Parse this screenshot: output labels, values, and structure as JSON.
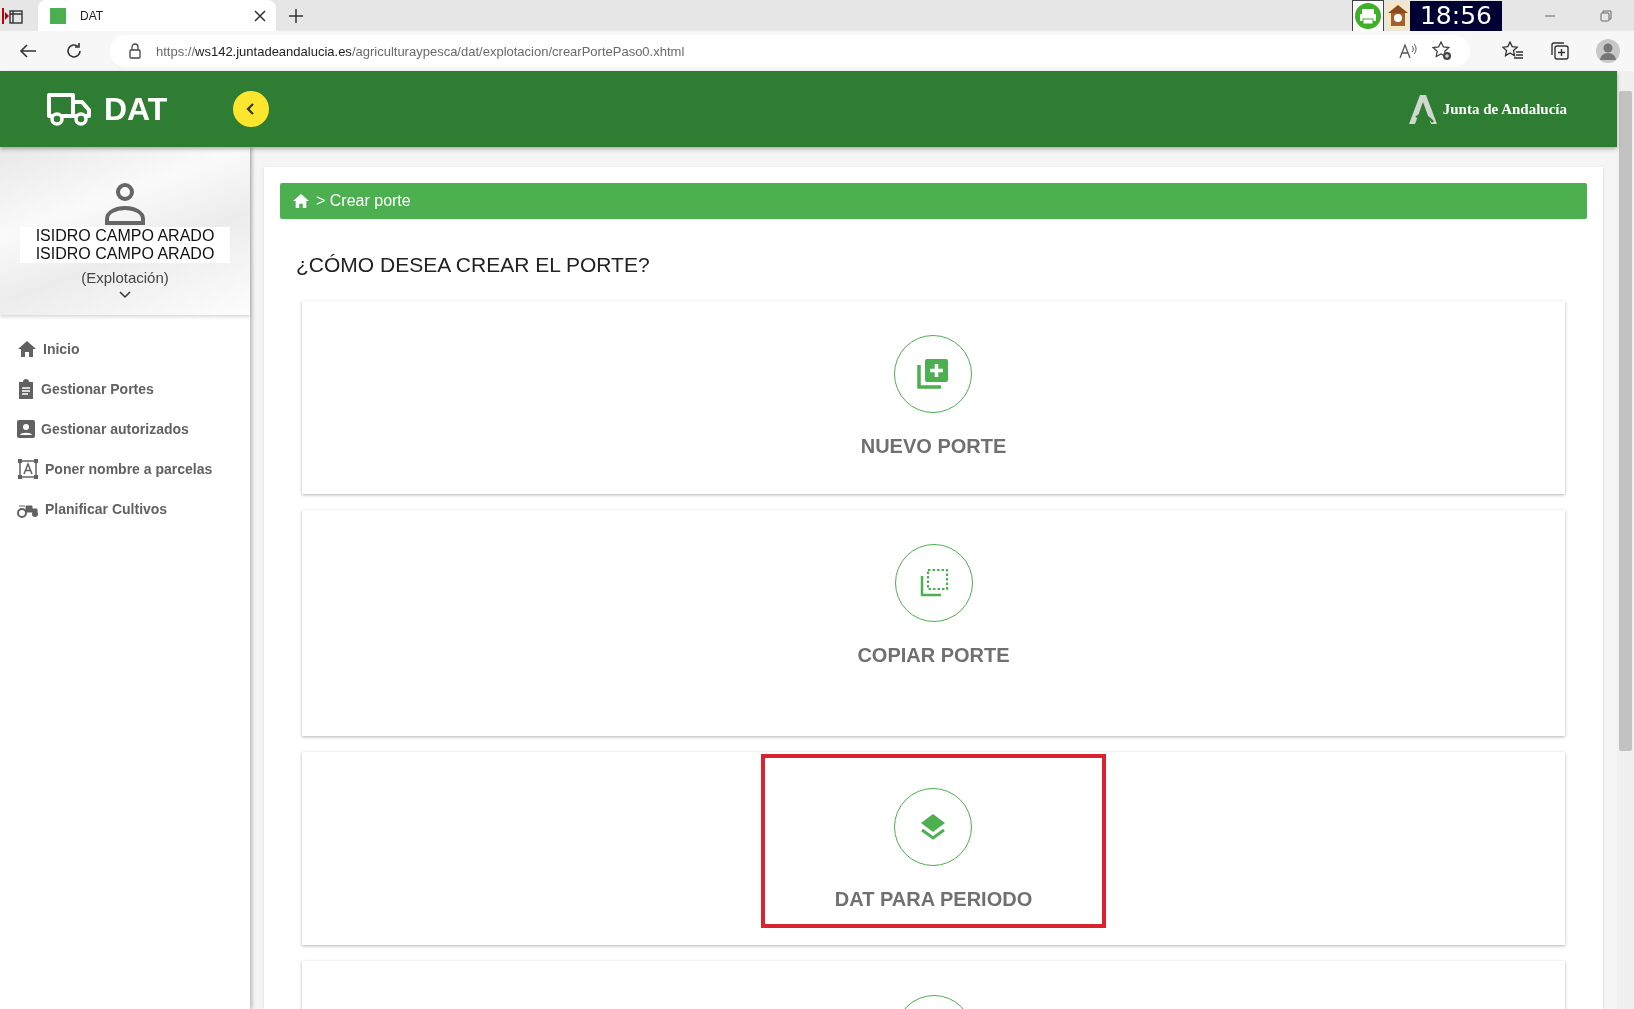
{
  "browser": {
    "tab": {
      "title": "DAT"
    },
    "clock": "18:56",
    "url": {
      "scheme": "https://",
      "host": "ws142.juntadeandalucia.es",
      "path": "/agriculturaypesca/dat/explotacion/crearPortePaso0.xhtml"
    }
  },
  "header": {
    "app_name": "DAT",
    "brand": "Junta de Andalucía",
    "sidebar_expanded": true
  },
  "profile": {
    "name_lines": [
      "ISIDRO CAMPO ARADO",
      "ISIDRO CAMPO ARADO"
    ],
    "role": "(Explotación)"
  },
  "menu": [
    {
      "label": "Inicio",
      "kind": "home"
    },
    {
      "label": "Gestionar Portes",
      "kind": "clipboard"
    },
    {
      "label": "Gestionar autorizados",
      "kind": "badge"
    },
    {
      "label": "Poner nombre a parcelas",
      "kind": "frame"
    },
    {
      "label": "Planificar Cultivos",
      "kind": "tractor"
    }
  ],
  "breadcrumb": {
    "current": "> Crear porte"
  },
  "title": "¿CÓMO DESEA CREAR EL PORTE?",
  "options": [
    {
      "label": "NUEVO PORTE",
      "kind": "new",
      "highlighted": false
    },
    {
      "label": "COPIAR PORTE",
      "kind": "copy",
      "highlighted": false
    },
    {
      "label": "DAT PARA PERIODO",
      "kind": "period",
      "highlighted": true
    },
    {
      "kind": "other",
      "highlighted": false
    }
  ]
}
